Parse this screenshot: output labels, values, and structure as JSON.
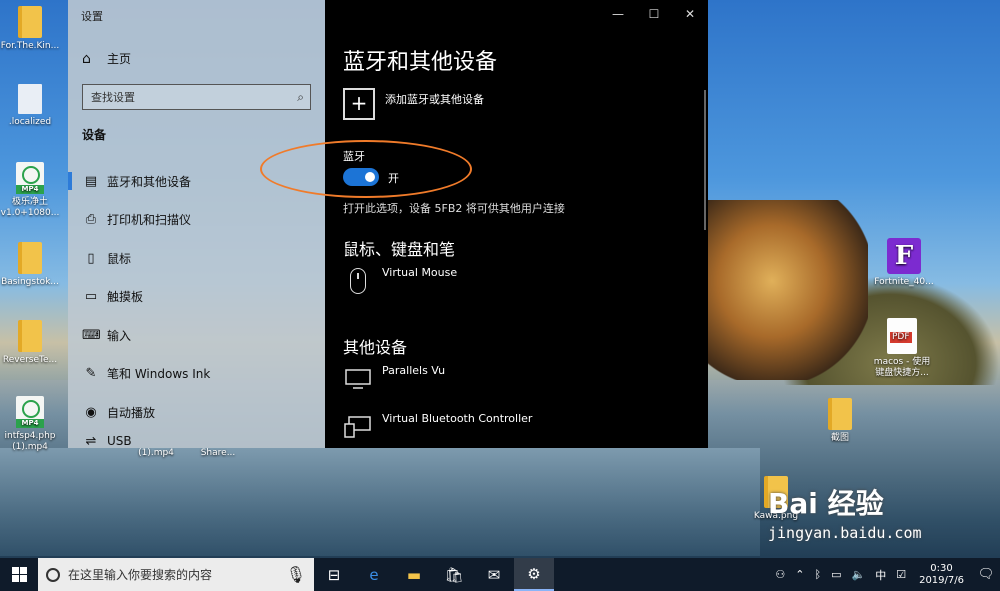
{
  "desktop_icons": [
    {
      "label": "For.The.Kin...",
      "type": "folder"
    },
    {
      "label": ".localized",
      "type": "file"
    },
    {
      "label": "极乐净土 v1.0+1080...",
      "type": "mp4"
    },
    {
      "label": "Basingstok...",
      "type": "folder"
    },
    {
      "label": "ReverseTe...",
      "type": "folder"
    },
    {
      "label": "intfsp4.php (1).mp4",
      "type": "mp4"
    },
    {
      "label": "(1).mp4",
      "type": "blur"
    },
    {
      "label": "Share...",
      "type": "blur"
    },
    {
      "label": "Fortnite_40...",
      "type": "fortnite"
    },
    {
      "label": "macos - 使用 键盘快捷方...",
      "type": "pdf"
    },
    {
      "label": "截图",
      "type": "folder"
    },
    {
      "label": "Kawa.png",
      "type": "folder"
    }
  ],
  "settings": {
    "window_title": "设置",
    "home_label": "主页",
    "search_placeholder": "查找设置",
    "section_label": "设备",
    "nav_items": [
      {
        "label": "蓝牙和其他设备",
        "icon": "bluetooth-devices-icon",
        "active": true
      },
      {
        "label": "打印机和扫描仪",
        "icon": "printer-icon",
        "active": false
      },
      {
        "label": "鼠标",
        "icon": "mouse-icon",
        "active": false
      },
      {
        "label": "触摸板",
        "icon": "touchpad-icon",
        "active": false
      },
      {
        "label": "输入",
        "icon": "keyboard-icon",
        "active": false
      },
      {
        "label": "笔和 Windows Ink",
        "icon": "pen-icon",
        "active": false
      },
      {
        "label": "自动播放",
        "icon": "autoplay-icon",
        "active": false
      },
      {
        "label": "USB",
        "icon": "usb-icon",
        "active": false
      }
    ],
    "content": {
      "title": "蓝牙和其他设备",
      "add_device_label": "添加蓝牙或其他设备",
      "bluetooth_label": "蓝牙",
      "bluetooth_state_text": "开",
      "bluetooth_on": true,
      "bluetooth_description": "打开此选项，设备 5FB2 将可供其他用户连接",
      "section_mouse_keyboard_pen": "鼠标、键盘和笔",
      "mouse_devices": [
        {
          "name": "Virtual Mouse",
          "icon": "mouse-icon"
        }
      ],
      "section_other_devices": "其他设备",
      "other_devices": [
        {
          "name": "Parallels Vu",
          "icon": "monitor-icon"
        },
        {
          "name": "Virtual Bluetooth Controller",
          "icon": "controller-icon"
        }
      ]
    },
    "window_controls": {
      "minimize": "—",
      "maximize": "☐",
      "close": "✕"
    },
    "highlight_color": "#f07b2a",
    "accent_color": "#1c74d6"
  },
  "taskbar": {
    "search_placeholder": "在这里输入你要搜索的内容",
    "apps": [
      "task-view-icon",
      "edge-icon",
      "file-explorer-icon",
      "store-icon",
      "mail-icon",
      "settings-icon"
    ],
    "tray_input_method": "中",
    "time": "0:30",
    "date": "2019/7/6"
  },
  "watermark": {
    "brand": "Bai 经验",
    "url": "jingyan.baidu.com"
  }
}
